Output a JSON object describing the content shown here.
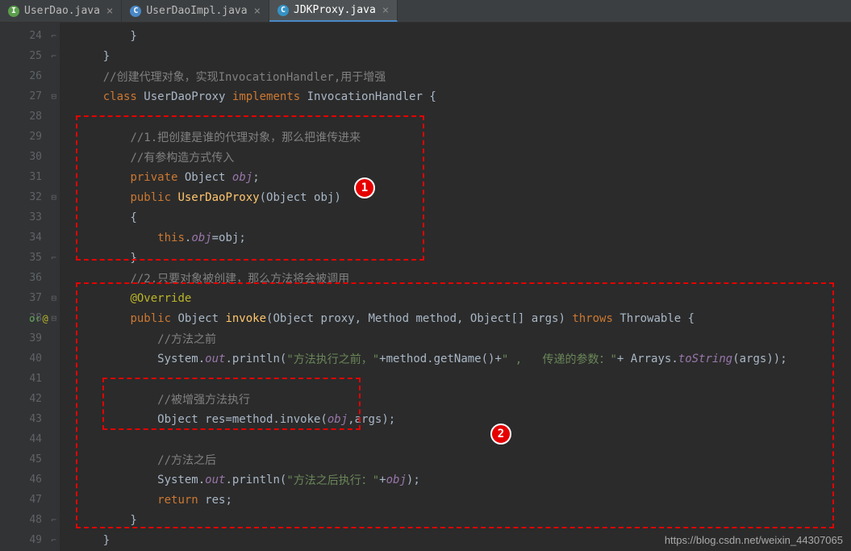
{
  "tabs": [
    {
      "label": "UserDao.java",
      "icon": "I"
    },
    {
      "label": "UserDaoImpl.java",
      "icon": "C"
    },
    {
      "label": "JDKProxy.java",
      "icon": "C"
    }
  ],
  "lines": {
    "start": 24,
    "end": 49
  },
  "code": {
    "l24": "        }",
    "l25": "    }",
    "l26_a": "    ",
    "l26_b": "//创建代理对象，实现InvocationHandler,用于增强",
    "l27_a": "    ",
    "l27_b": "class",
    "l27_c": " UserDaoProxy ",
    "l27_d": "implements",
    "l27_e": " InvocationHandler {",
    "l29_a": "        ",
    "l29_b": "//1.把创建是谁的代理对象，那么把谁传进来",
    "l30_a": "        ",
    "l30_b": "//有参构造方式传入",
    "l31_a": "        ",
    "l31_b": "private",
    "l31_c": " Object ",
    "l31_d": "obj",
    "l31_e": ";",
    "l32_a": "        ",
    "l32_b": "public",
    "l32_c": " ",
    "l32_d": "UserDaoProxy",
    "l32_e": "(Object obj)",
    "l33": "        {",
    "l34_a": "            ",
    "l34_b": "this",
    "l34_c": ".",
    "l34_d": "obj",
    "l34_e": "=obj;",
    "l35": "        }",
    "l36_a": "        ",
    "l36_b": "//2.只要对象被创建，那么方法将会被调用",
    "l37_a": "        ",
    "l37_b": "@Override",
    "l38_a": "        ",
    "l38_b": "public",
    "l38_c": " Object ",
    "l38_d": "invoke",
    "l38_e": "(Object proxy, Method method, Object[] args) ",
    "l38_f": "throws",
    "l38_g": " Throwable {",
    "l39_a": "            ",
    "l39_b": "//方法之前",
    "l40_a": "            System.",
    "l40_b": "out",
    "l40_c": ".println(",
    "l40_d": "\"方法执行之前，\"",
    "l40_e": "+method.getName()+",
    "l40_f": "\" ,   传递的参数：\"",
    "l40_g": "+ Arrays.",
    "l40_h": "toString",
    "l40_i": "(args));",
    "l42_a": "            ",
    "l42_b": "//被增强方法执行",
    "l43_a": "            Object res=method.invoke(",
    "l43_b": "obj",
    "l43_c": ",args);",
    "l45_a": "            ",
    "l45_b": "//方法之后",
    "l46_a": "            System.",
    "l46_b": "out",
    "l46_c": ".println(",
    "l46_d": "\"方法之后执行：\"",
    "l46_e": "+",
    "l46_f": "obj",
    "l46_g": ");",
    "l47_a": "            ",
    "l47_b": "return",
    "l47_c": " res;",
    "l48": "        }",
    "l49": "    }"
  },
  "markers": {
    "m1": "1",
    "m2": "2"
  },
  "watermark": "https://blog.csdn.net/weixin_44307065"
}
